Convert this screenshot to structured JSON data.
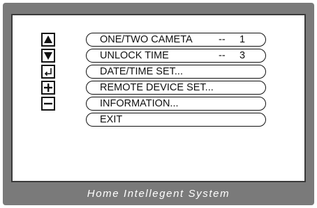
{
  "footer": {
    "brand": "Home Intellegent System"
  },
  "icons": [
    {
      "name": "up-arrow-icon"
    },
    {
      "name": "down-arrow-icon"
    },
    {
      "name": "enter-icon"
    },
    {
      "name": "plus-icon"
    },
    {
      "name": "minus-icon"
    }
  ],
  "menu": {
    "items": [
      {
        "label": "ONE/TWO CAMETA",
        "separator": "--",
        "value": "1"
      },
      {
        "label": "UNLOCK TIME",
        "separator": "--",
        "value": "3"
      },
      {
        "label": "DATE/TIME SET..."
      },
      {
        "label": "REMOTE DEVICE SET..."
      },
      {
        "label": "INFORMATION..."
      },
      {
        "label": "EXIT"
      }
    ]
  }
}
